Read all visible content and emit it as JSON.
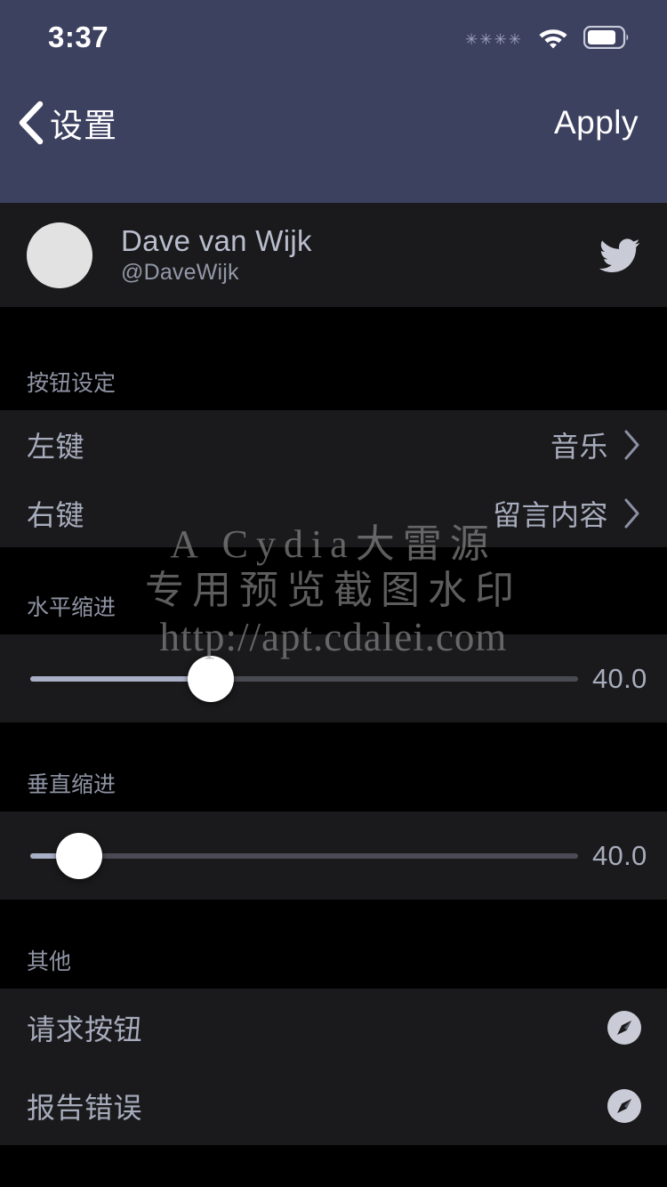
{
  "status_bar": {
    "time": "3:37",
    "signal_dots": "✳✳✳✳",
    "wifi_icon": "wifi-icon",
    "battery_icon": "battery-icon"
  },
  "nav": {
    "back_icon": "back-chevron-icon",
    "back_label": "设置",
    "apply_label": "Apply"
  },
  "profile": {
    "avatar": "avatar-placeholder",
    "name": "Dave van Wijk",
    "handle": "@DaveWijk",
    "social_icon": "twitter-icon"
  },
  "sections": [
    {
      "header": "按钮设定",
      "rows": [
        {
          "label": "左键",
          "value": "音乐",
          "accessory": "chevron-right-icon"
        },
        {
          "label": "右键",
          "value": "留言内容",
          "accessory": "chevron-right-icon"
        }
      ]
    },
    {
      "header": "水平缩进",
      "slider": {
        "value_text": "40.0",
        "percent": 33,
        "min": 0,
        "max": 100
      }
    },
    {
      "header": "垂直缩进",
      "slider": {
        "value_text": "40.0",
        "percent": 9,
        "min": 0,
        "max": 100
      }
    },
    {
      "header": "其他",
      "rows": [
        {
          "label": "请求按钮",
          "value": "",
          "accessory": "safari-icon"
        },
        {
          "label": "报告错误",
          "value": "",
          "accessory": "safari-icon"
        }
      ]
    }
  ],
  "watermark": {
    "line1": "A Cydia大雷源",
    "line2": "专用预览截图水印",
    "line3": "http://apt.cdalei.com"
  },
  "colors": {
    "navbar": "#3D4160",
    "page_background": "#000000",
    "row_background": "#1A1A1C",
    "primary_text": "#A7ACBC",
    "muted_text": "#8E93A3",
    "slider_fill": "#A9AFC4",
    "slider_track": "#4A4A52",
    "thumb": "#FFFFFF"
  }
}
